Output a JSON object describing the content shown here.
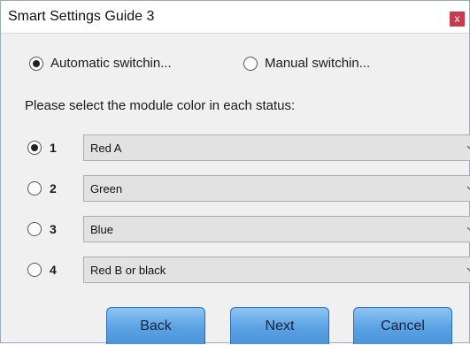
{
  "window": {
    "title": "Smart Settings Guide 3",
    "close_glyph": "x"
  },
  "mode": {
    "options": [
      {
        "label": "Automatic switchin...",
        "checked": true
      },
      {
        "label": "Manual switchin...",
        "checked": false
      }
    ]
  },
  "prompt": "Please select the module color in each status:",
  "statuses": [
    {
      "number": "1",
      "checked": true,
      "value": "Red A"
    },
    {
      "number": "2",
      "checked": false,
      "value": "Green"
    },
    {
      "number": "3",
      "checked": false,
      "value": "Blue"
    },
    {
      "number": "4",
      "checked": false,
      "value": "Red B or black"
    }
  ],
  "buttons": {
    "back": "Back",
    "next": "Next",
    "cancel": "Cancel"
  },
  "colors": {
    "close_bg": "#c63c4a",
    "button_gradient_top": "#8fc4f2",
    "button_gradient_bottom": "#4c95db"
  }
}
